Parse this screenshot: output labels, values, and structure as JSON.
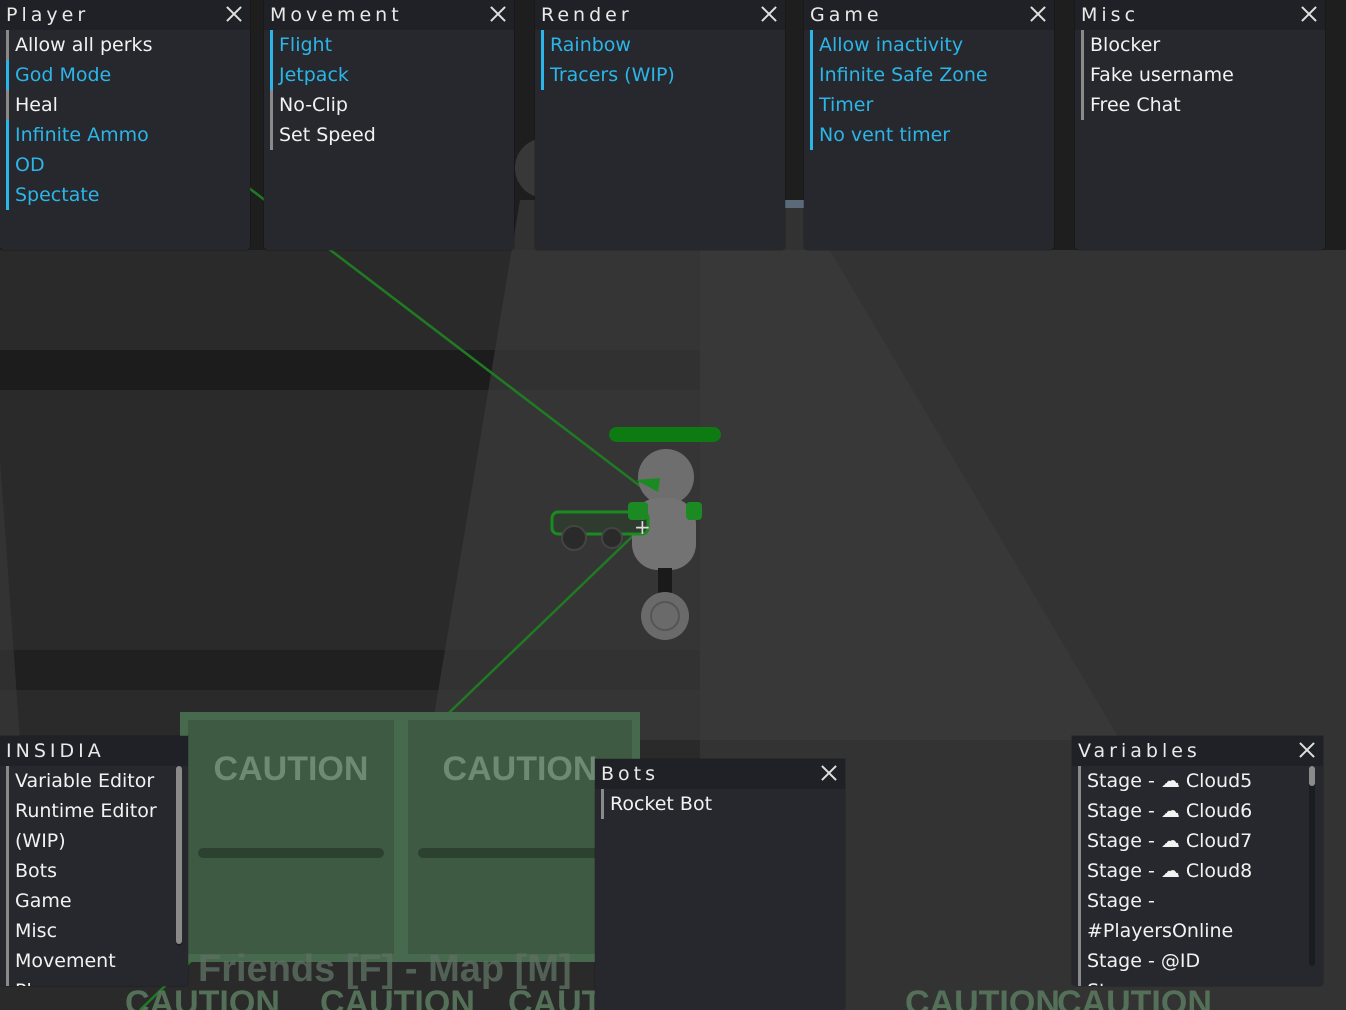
{
  "panels": {
    "player": {
      "title": "Player",
      "items": [
        {
          "label": "Allow all perks",
          "active": false
        },
        {
          "label": "God Mode",
          "active": true
        },
        {
          "label": "Heal",
          "active": false
        },
        {
          "label": "Infinite Ammo",
          "active": true
        },
        {
          "label": "OD",
          "active": true
        },
        {
          "label": "Spectate",
          "active": true
        }
      ]
    },
    "movement": {
      "title": "Movement",
      "items": [
        {
          "label": "Flight",
          "active": true
        },
        {
          "label": "Jetpack",
          "active": true
        },
        {
          "label": "No-Clip",
          "active": false
        },
        {
          "label": "Set Speed",
          "active": false
        }
      ]
    },
    "render": {
      "title": "Render",
      "items": [
        {
          "label": "Rainbow",
          "active": true
        },
        {
          "label": "Tracers (WIP)",
          "active": true
        }
      ]
    },
    "game": {
      "title": "Game",
      "items": [
        {
          "label": "Allow inactivity",
          "active": true
        },
        {
          "label": "Infinite Safe Zone",
          "active": true
        },
        {
          "label": "Timer",
          "active": true
        },
        {
          "label": "No vent timer",
          "active": true
        }
      ]
    },
    "misc": {
      "title": "Misc",
      "items": [
        {
          "label": "Blocker",
          "active": false
        },
        {
          "label": "Fake username",
          "active": false
        },
        {
          "label": "Free Chat",
          "active": false
        }
      ]
    },
    "insidia": {
      "title": "INSIDIA",
      "items": [
        {
          "label": "Variable Editor"
        },
        {
          "label": "Runtime Editor"
        },
        {
          "label": "(WIP)"
        },
        {
          "label": "Bots"
        },
        {
          "label": "Game"
        },
        {
          "label": "Misc"
        },
        {
          "label": "Movement"
        },
        {
          "label": "Player"
        }
      ]
    },
    "bots": {
      "title": "Bots",
      "items": [
        {
          "label": "Rocket Bot",
          "active": false
        }
      ]
    },
    "variables": {
      "title": "Variables",
      "items": [
        {
          "label": "Stage - ☁ Cloud5"
        },
        {
          "label": "Stage - ☁ Cloud6"
        },
        {
          "label": "Stage - ☁ Cloud7"
        },
        {
          "label": "Stage - ☁ Cloud8"
        },
        {
          "label": "Stage -"
        },
        {
          "label": "#PlayersOnline"
        },
        {
          "label": "Stage - @ID"
        },
        {
          "label": "Stage -"
        }
      ]
    }
  },
  "scene": {
    "caution_labels": [
      "CAUTION",
      "CAUTION",
      "CAUTION",
      "CAUTION",
      "CAUTION",
      "CAUTION",
      "CAUTION"
    ],
    "floor_text": "Friends [F] - Map [M]"
  },
  "colors": {
    "active": "#2cb5e8",
    "panel_bg": "#26282e",
    "header_bg": "#1f2126",
    "health_bar": "#0e7a12"
  },
  "icons": {
    "close": "close-icon",
    "cloud": "cloud-icon"
  }
}
